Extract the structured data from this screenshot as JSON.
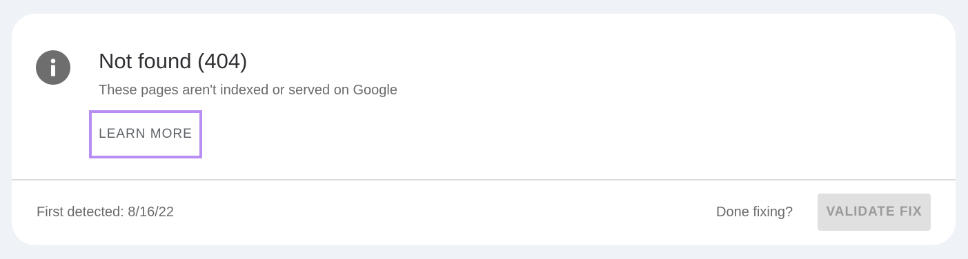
{
  "issue": {
    "icon": "info-icon",
    "title": "Not found (404)",
    "description": "These pages aren't indexed or served on Google",
    "learn_more_label": "LEARN MORE"
  },
  "footer": {
    "first_detected": "First detected: 8/16/22",
    "done_fixing_label": "Done fixing?",
    "validate_fix_label": "VALIDATE FIX"
  },
  "colors": {
    "highlight_border": "#b98ef3",
    "icon_fill": "#6e6e6e",
    "page_background": "#eff2f7",
    "disabled_button": "#e0e0e0"
  }
}
